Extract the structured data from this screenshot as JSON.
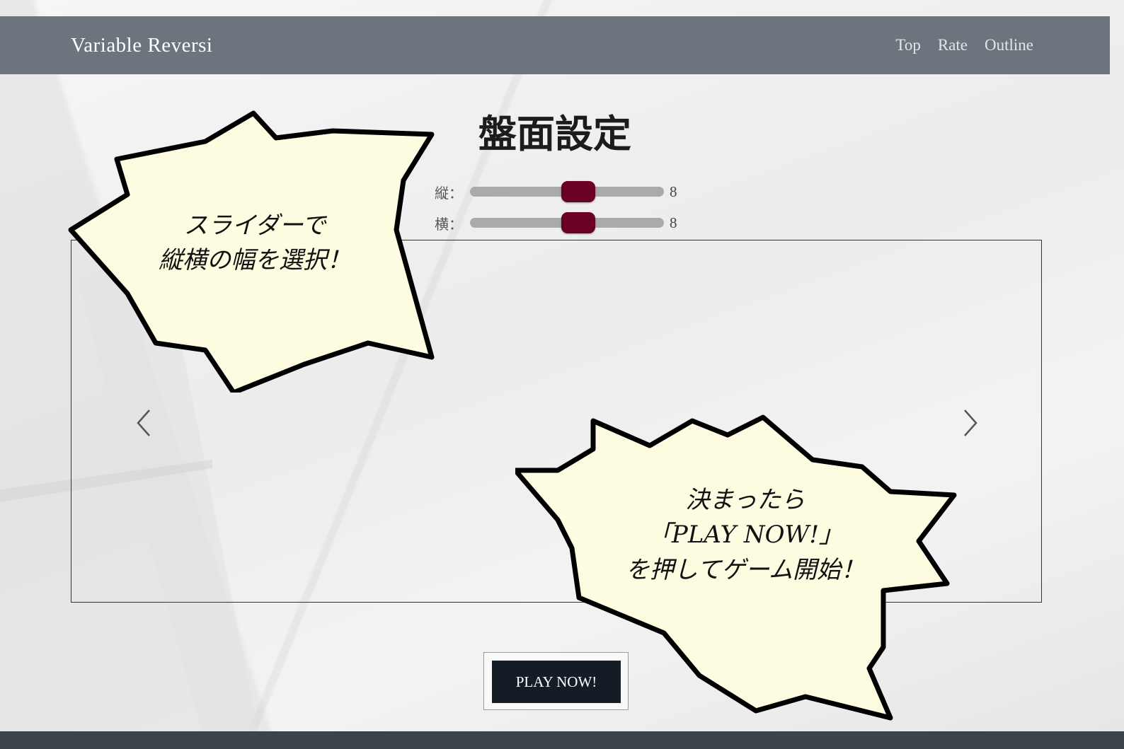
{
  "navbar": {
    "brand": "Variable Reversi",
    "links": [
      {
        "label": "Top"
      },
      {
        "label": "Rate"
      },
      {
        "label": "Outline"
      }
    ]
  },
  "page_title": "盤面設定",
  "sliders": [
    {
      "label": "縦：",
      "value": "8",
      "fill_fraction": 0.57
    },
    {
      "label": "横：",
      "value": "8",
      "fill_fraction": 0.57
    }
  ],
  "carousel": {
    "prev_icon": "chevron-left-icon",
    "next_icon": "chevron-right-icon"
  },
  "bubbles": [
    {
      "lines": [
        "スライダーで",
        "縦横の幅を選択！"
      ]
    },
    {
      "lines": [
        "決まったら",
        "「PLAY NOW!」",
        "を押してゲーム開始！"
      ]
    }
  ],
  "play_button": "PLAY NOW!",
  "colors": {
    "navbar": "#6c757d",
    "slider_thumb": "#6a0022",
    "slider_track": "#aaaaaa",
    "bubble_fill": "#fdfbe0",
    "play_button": "#141c26"
  }
}
